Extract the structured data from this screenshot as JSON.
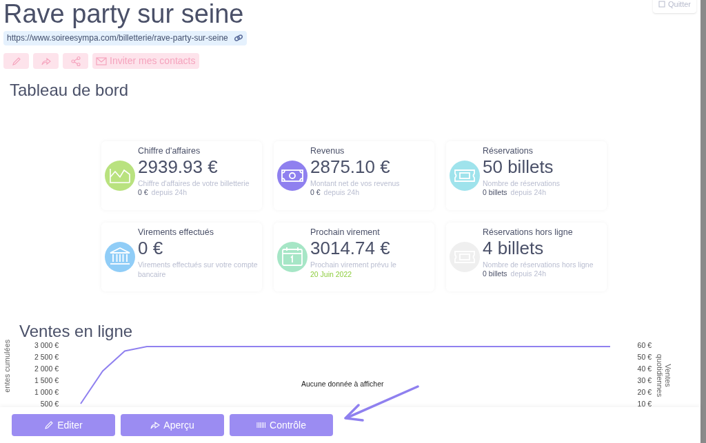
{
  "header": {
    "title": "Rave party sur seine",
    "url": "https://www.soireesympa.com/billetterie/rave-party-sur-seine",
    "quit_label": "Quitter"
  },
  "actions": [
    {
      "kind": "edit"
    },
    {
      "kind": "share"
    },
    {
      "kind": "network"
    },
    {
      "kind": "invite",
      "label": "Inviter mes contacts"
    }
  ],
  "dashboard": {
    "title": "Tableau de bord",
    "cards": [
      {
        "kind": "chart",
        "color": "#b9e27f",
        "title": "Chiffre d'affaires",
        "value": "2939.93 €",
        "description": "Chiffre d'affaires de votre billetterie",
        "footer_value": "0 €",
        "footer_label": "depuis 24h"
      },
      {
        "kind": "money",
        "color": "#8f80ef",
        "title": "Revenus",
        "value": "2875.10 €",
        "description": "Montant net de vos revenus",
        "footer_value": "0 €",
        "footer_label": "depuis 24h"
      },
      {
        "kind": "ticket",
        "color": "#9fe3ec",
        "title": "Réservations",
        "value": "50 billets",
        "description": "Nombre de réservations",
        "footer_value": "0 billets",
        "footer_label": "depuis 24h"
      },
      {
        "kind": "bank",
        "color": "#90cdf7",
        "title": "Virements effectués",
        "value": "0 €",
        "description": "Virements effectués sur votre compte bancaire"
      },
      {
        "kind": "calendar",
        "color": "#a6e6c6",
        "title": "Prochain virement",
        "value": "3014.74 €",
        "description": "Prochain virement prévu le",
        "date": "20 Juin 2022"
      },
      {
        "kind": "ticket",
        "color": "#efefef",
        "title": "Réservations hors ligne",
        "value": "4 billets",
        "description": "Nombre de réservations hors ligne",
        "footer_value": "0 billets",
        "footer_label": "depuis 24h"
      }
    ]
  },
  "sales": {
    "title": "Ventes en ligne",
    "empty_message": "Aucune donnée à afficher",
    "right_axis": {
      "label": "Ventes quotidiennes",
      "ticks": [
        "60 €",
        "50 €",
        "40 €",
        "30 €",
        "20 €",
        "10 €"
      ]
    },
    "chart_data": {
      "type": "line",
      "ylabel": "entes cumulées",
      "ylim": [
        500,
        3000
      ],
      "yticks": [
        {
          "value": 3000,
          "label": "3 000 €"
        },
        {
          "value": 2500,
          "label": "2 500 €"
        },
        {
          "value": 2000,
          "label": "2 000 €"
        },
        {
          "value": 1500,
          "label": "1 500 €"
        },
        {
          "value": 1000,
          "label": "1 000 €"
        },
        {
          "value": 500,
          "label": "500 €"
        }
      ],
      "series": [
        {
          "color": "#8f80ef",
          "values": [
            500,
            1900,
            2750,
            2940,
            2940,
            2940,
            2940,
            2940,
            2940,
            2940,
            2940,
            2940,
            2940,
            2940,
            2940,
            2940,
            2940,
            2940,
            2940,
            2940,
            2940,
            2940,
            2940,
            2940,
            2940
          ]
        }
      ]
    }
  },
  "footer_buttons": [
    {
      "kind": "edit",
      "label": "Editer"
    },
    {
      "kind": "preview",
      "label": "Aperçu"
    },
    {
      "kind": "control",
      "label": "Contrôle"
    }
  ]
}
